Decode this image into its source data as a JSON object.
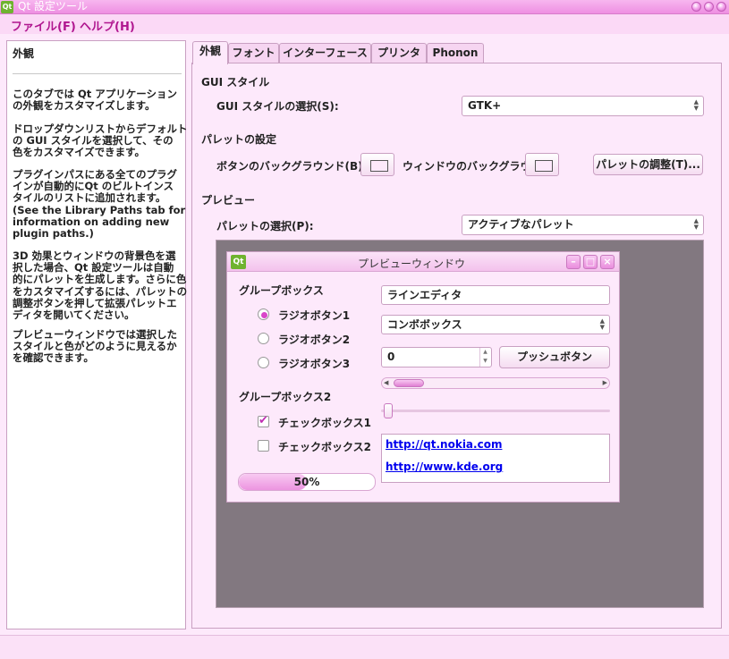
{
  "window": {
    "title": "Qt 設定ツール"
  },
  "menu": {
    "file": "ファイル(F)",
    "help": "ヘルプ(H)"
  },
  "left_panel": {
    "heading": "外観",
    "paragraphs": [
      "このタブでは Qt アプリケーション\nの外観をカスタマイズします。",
      "ドロップダウンリストからデフォルト\nの GUI スタイルを選択して、その\n色をカスタマイズできます。",
      "プラグインパスにある全てのプラグ\nインが自動的にQt のビルトインス\nタイルのリストに追加されます。\n(See the Library Paths tab for\ninformation on adding new\nplugin paths.)",
      "3D 効果とウィンドウの背景色を選\n択した場合、Qt 設定ツールは自動\n的にパレットを生成します。さらに色\nをカスタマイズするには、パレットの\n調整ボタンを押して拡張パレットエ\nディタを開いてください。",
      "プレビューウィンドウでは選択した\nスタイルと色がどのように見えるか\nを確認できます。"
    ]
  },
  "tabs": [
    {
      "label": "外観"
    },
    {
      "label": "フォント"
    },
    {
      "label": "インターフェース"
    },
    {
      "label": "プリンタ"
    },
    {
      "label": "Phonon"
    }
  ],
  "gui_style": {
    "section": "GUI スタイル",
    "label": "GUI スタイルの選択(S):",
    "value": "GTK+"
  },
  "palette": {
    "section": "パレットの設定",
    "button_bg_label": "ボタンのバックグラウンド(B):",
    "window_bg_label": "ウィンドウのバックグラウ:",
    "adjust_button": "パレットの調整(T)..."
  },
  "preview": {
    "section": "プレビュー",
    "palette_label": "パレットの選択(P):",
    "palette_value": "アクティブなパレット"
  },
  "preview_window": {
    "title": "プレビューウィンドウ",
    "groupbox1": "グループボックス",
    "radios": [
      "ラジオボタン1",
      "ラジオボタン2",
      "ラジオボタン3"
    ],
    "groupbox2": "グループボックス2",
    "checkboxes": [
      "チェックボックス1",
      "チェックボックス2"
    ],
    "progress_text": "50%",
    "progress_value": 0.5,
    "line_edit": "ラインエディタ",
    "combo": "コンボボックス",
    "spin_value": "0",
    "push_button": "プッシュボタン",
    "links": [
      "http://qt.nokia.com",
      "http://www.kde.org"
    ]
  },
  "colors": {
    "accent": "#f3a9ea",
    "link": "#0000ee",
    "preview_bg": "#827880"
  }
}
